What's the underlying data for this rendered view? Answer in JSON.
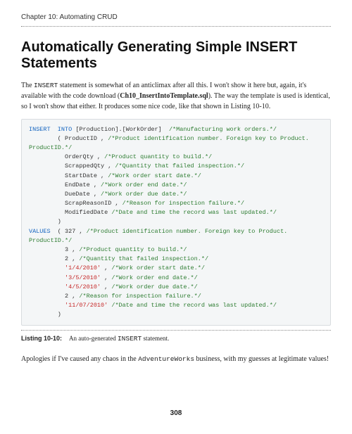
{
  "chapter": "Chapter 10: Automating CRUD",
  "heading": "Automatically Generating Simple INSERT Statements",
  "para1_a": "The ",
  "para1_mono1": "INSERT",
  "para1_b": " statement is somewhat of an anticlimax after all this. I won't show it here but, again, it's available with the code download (",
  "para1_bold": "Ch10_InsertIntoTemplate.sql",
  "para1_c": "). The way the template is used is identical, so I won't show that either. It produces some nice code, like that shown in Listing 10-10.",
  "code": {
    "l1_a": "INSERT",
    "l1_b": "  INTO",
    "l1_c": " [Production].[WorkOrder]  ",
    "l1_d": "/*Manufacturing work orders.*/",
    "l2_a": "        ( ProductID , ",
    "l2_b": "/*Product identification number. Foreign key to Product.",
    "l3": "ProductID.*/",
    "l4_a": "          OrderQty , ",
    "l4_b": "/*Product quantity to build.*/",
    "l5_a": "          ScrappedQty , ",
    "l5_b": "/*Quantity that failed inspection.*/",
    "l6_a": "          StartDate , ",
    "l6_b": "/*Work order start date.*/",
    "l7_a": "          EndDate , ",
    "l7_b": "/*Work order end date.*/",
    "l8_a": "          DueDate , ",
    "l8_b": "/*Work order due date.*/",
    "l9_a": "          ScrapReasonID , ",
    "l9_b": "/*Reason for inspection failure.*/",
    "l10_a": "          ModifiedDate ",
    "l10_b": "/*Date and time the record was last updated.*/",
    "l11": "        )",
    "l12_a": "VALUES",
    "l12_b": "  ( 327 , ",
    "l12_c": "/*Product identification number. Foreign key to Product.",
    "l13": "ProductID.*/",
    "l14_a": "          3 , ",
    "l14_b": "/*Product quantity to build.*/",
    "l15_a": "          2 , ",
    "l15_b": "/*Quantity that failed inspection.*/",
    "l16_a": "          ",
    "l16_b": "'1/4/2010'",
    "l16_c": " , ",
    "l16_d": "/*Work order start date.*/",
    "l17_a": "          ",
    "l17_b": "'3/5/2010'",
    "l17_c": " , ",
    "l17_d": "/*Work order end date.*/",
    "l18_a": "          ",
    "l18_b": "'4/5/2010'",
    "l18_c": " , ",
    "l18_d": "/*Work order due date.*/",
    "l19_a": "          2 , ",
    "l19_b": "/*Reason for inspection failure.*/",
    "l20_a": "          ",
    "l20_b": "'11/07/2010'",
    "l20_c": " ",
    "l20_d": "/*Date and time the record was last updated.*/",
    "l21": "        )"
  },
  "listing_label": "Listing 10-10:",
  "listing_text_a": "An auto-generated ",
  "listing_mono": "INSERT",
  "listing_text_b": " statement.",
  "para2_a": "Apologies if I've caused any chaos in the ",
  "para2_mono": "AdventureWorks",
  "para2_b": " business, with my guesses at legitimate values!",
  "page_number": "308"
}
